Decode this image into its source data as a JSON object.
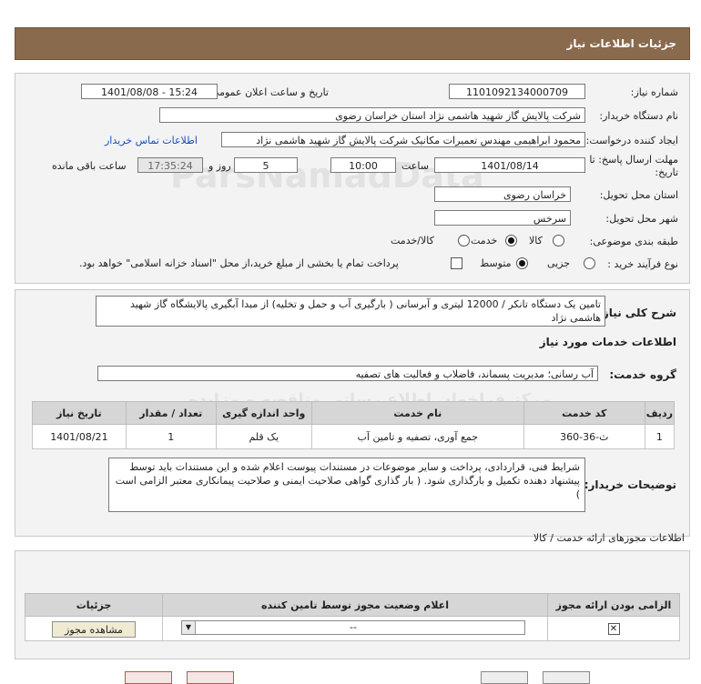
{
  "header": {
    "title": "جزئیات اطلاعات نیاز"
  },
  "form": {
    "need_number": {
      "label": "شماره نیاز:",
      "value": "1101092134000709"
    },
    "announce": {
      "label": "تاریخ و ساعت اعلان عمومی:",
      "value": "1401/08/08 - 15:24"
    },
    "buyer": {
      "label": "نام دستگاه خریدار:",
      "value": "شرکت پالایش گاز شهید هاشمی نژاد   استان خراسان رضوی"
    },
    "requester": {
      "label": "ایجاد کننده درخواست:",
      "value": "محمود ابراهیمی مهندس تعمیرات مکانیک شرکت پالایش گاز شهید هاشمی نژاد",
      "contact_link": "اطلاعات تماس خریدار"
    },
    "deadline": {
      "label_1": "مهلت ارسال پاسخ: تا",
      "label_2": "تاریخ:",
      "date": "1401/08/14",
      "time_label": "ساعت",
      "time": "10:00",
      "days": "5",
      "days_label": "روز و",
      "remaining": "17:35:24",
      "remaining_label": "ساعت باقی مانده"
    },
    "province": {
      "label": "استان محل تحویل:",
      "value": "خراسان رضوی"
    },
    "city": {
      "label": "شهر محل تحویل:",
      "value": "سرخس"
    },
    "category": {
      "label": "طبقه بندی موضوعی:",
      "options": [
        "کالا",
        "خدمت",
        "کالا/خدمت"
      ],
      "selected": "خدمت"
    },
    "process": {
      "label": "نوع فرآیند خرید :",
      "options": [
        "جزیی",
        "متوسط"
      ],
      "selected": "متوسط",
      "note": "پرداخت تمام یا بخشی از مبلغ خرید،از محل \"اسناد خزانه اسلامی\" خواهد بود."
    }
  },
  "description": {
    "label": "شرح کلی نیاز:",
    "value": "تامین یک دستگاه تانکر /  12000 لیتری و آبرسانی ( بارگیری آب و حمل و تخلیه) از مبدا آبگیری پالایشگاه گاز شهید هاشمی نژاد"
  },
  "services": {
    "section_title": "اطلاعات خدمات مورد نیاز",
    "group_label": "گروه خدمت:",
    "group_value": "آب رسانی؛ مدیریت پسماند، فاضلاب و فعالیت های تصفیه",
    "columns": [
      "ردیف",
      "کد خدمت",
      "نام خدمت",
      "واحد اندازه گیری",
      "تعداد / مقدار",
      "تاریخ نیاز"
    ],
    "rows": [
      {
        "row": "1",
        "code": "ث-36-360",
        "name": "جمع آوری، تصفیه و تامین آب",
        "unit": "یک قلم",
        "qty": "1",
        "date": "1401/08/21"
      }
    ]
  },
  "buyer_notes": {
    "label": "توضیحات خریدار:",
    "value": "شرایط فنی، قراردادی، پرداخت و سایر موضوعات در مستندات پیوست اعلام شده و این مستندات باید توسط پیشنهاد دهنده تکمیل و  بارگذاری شود. ( بار گذاری گواهی صلاحیت ایمنی و صلاحیت پیمانکاری معتبر الزامی است )"
  },
  "permits": {
    "title": "اطلاعات مجوزهای ارائه خدمت / کالا",
    "columns": [
      "الزامی بودن ارائه مجوز",
      "اعلام وضعیت مجوز توسط تامین کننده",
      "جزئیات"
    ],
    "rows": [
      {
        "status_value": "--",
        "button_label": "مشاهده مجوز"
      }
    ]
  },
  "watermark": {
    "line1": "ParsNamadData",
    "line2": "مرکز فراخوان اطلاع رسانی مناقصه و مزایده"
  },
  "colors": {
    "header_bg": "#8a6a4c",
    "panel_bg": "#f3f3f3",
    "link": "#1a4fb3"
  }
}
